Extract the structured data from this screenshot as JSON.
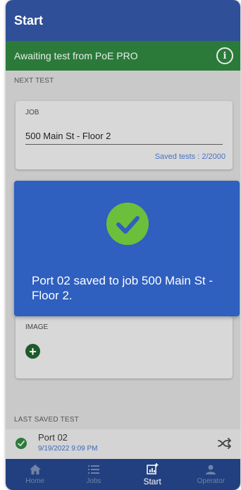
{
  "header": {
    "title": "Start"
  },
  "status": {
    "text": "Awaiting test from PoE PRO",
    "icon": "info-icon"
  },
  "next_test": {
    "section_label": "NEXT TEST",
    "job_label": "JOB",
    "job_value": "500 Main St - Floor 2",
    "saved_tests": "Saved tests : 2/2000"
  },
  "image_section": {
    "label": "IMAGE",
    "icon": "add-icon"
  },
  "overlay": {
    "icon": "check-circle-icon",
    "message": "Port 02 saved to job 500 Main St - Floor 2."
  },
  "last_saved": {
    "section_label": "LAST SAVED TEST",
    "port": "Port 02",
    "date": "9/19/2022 9:09 PM",
    "icon": "shuffle-icon"
  },
  "nav": {
    "items": [
      {
        "label": "Home",
        "icon": "home-icon",
        "active": false
      },
      {
        "label": "Jobs",
        "icon": "list-icon",
        "active": false
      },
      {
        "label": "Start",
        "icon": "chart-add-icon",
        "active": true
      },
      {
        "label": "Operator",
        "icon": "person-icon",
        "active": false
      }
    ]
  },
  "colors": {
    "header": "#2f4f98",
    "status_bar": "#2b7a3a",
    "overlay": "#2f5fbf",
    "check": "#6cbf3a",
    "nav": "#22407f"
  }
}
